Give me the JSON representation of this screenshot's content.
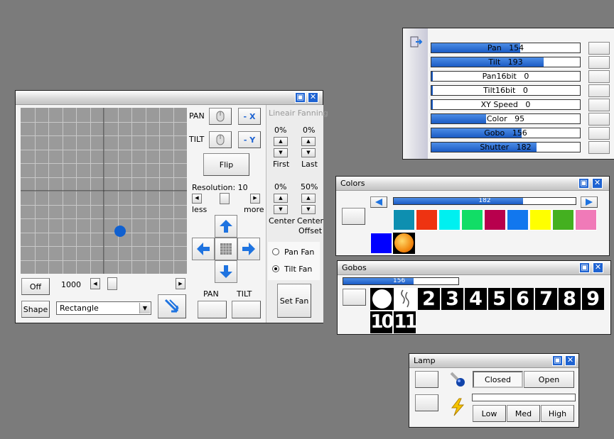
{
  "main_window": {
    "pan_label": "PAN",
    "tilt_label": "TILT",
    "neg_x_label": "- X",
    "neg_y_label": "- Y",
    "flip_label": "Flip",
    "resolution_label": "Resolution: 10",
    "less_label": "less",
    "more_label": "more",
    "off_label": "Off",
    "speed_value": "1000",
    "shape_label": "Shape",
    "shape_value": "Rectangle",
    "pan_box_label": "PAN",
    "tilt_box_label": "TILT",
    "fanning": {
      "title": "Lineair Fanning",
      "first_pct": "0%",
      "last_pct": "0%",
      "first_label": "First",
      "last_label": "Last",
      "center_pct": "0%",
      "center_offset_pct": "50%",
      "center_label": "Center",
      "center_offset_label1": "Center",
      "center_offset_label2": "Offset",
      "pan_fan_label": "Pan Fan",
      "tilt_fan_label": "Tilt Fan",
      "set_fan_label": "Set Fan",
      "selected_fan": "tilt"
    }
  },
  "channels": [
    {
      "label": "Pan",
      "value": "154",
      "level": 0.6
    },
    {
      "label": "Tilt",
      "value": "193",
      "level": 0.755
    },
    {
      "label": "Pan16bit",
      "value": "0",
      "level": 0
    },
    {
      "label": "Tilt16bit",
      "value": "0",
      "level": 0
    },
    {
      "label": "XY Speed",
      "value": "0",
      "level": 0
    },
    {
      "label": "Color",
      "value": "95",
      "level": 0.37
    },
    {
      "label": "Gobo",
      "value": "156",
      "level": 0.61
    },
    {
      "label": "Shutter",
      "value": "182",
      "level": 0.71
    }
  ],
  "colors_window": {
    "title": "Colors",
    "slider_value": "182",
    "slider_level": 0.71,
    "swatches": [
      "#0e8fb0",
      "#ee3311",
      "#00f0f0",
      "#11dd66",
      "#b8004d",
      "#1177ee",
      "#ffff00",
      "#44b020",
      "#f07ab8"
    ],
    "row2_swatch": "#0000ff"
  },
  "gobos_window": {
    "title": "Gobos",
    "slider_value": "156",
    "slider_level": 0.61,
    "gobo_numbers": [
      "2",
      "3",
      "4",
      "5",
      "6",
      "7",
      "8",
      "9"
    ],
    "gobo_numbers_row2": [
      "10",
      "11"
    ]
  },
  "lamp_window": {
    "title": "Lamp",
    "closed_label": "Closed",
    "open_label": "Open",
    "low_label": "Low",
    "med_label": "Med",
    "high_label": "High"
  },
  "colors": {
    "accent_blue": "#1e63d2",
    "position_dot": "#1060d0",
    "grid_bg": "#9a9a9a"
  }
}
